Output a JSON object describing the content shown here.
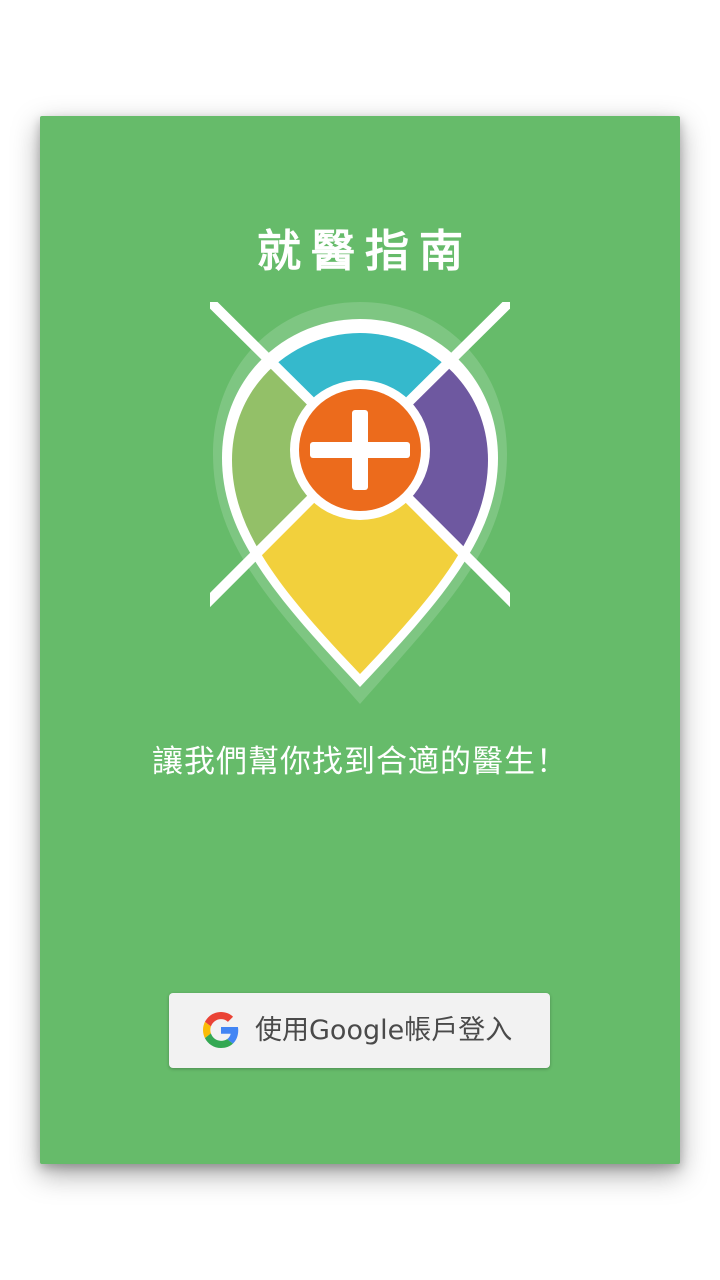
{
  "app": {
    "title": "就醫指南",
    "tagline": "讓我們幫你找到合適的醫生！"
  },
  "signin": {
    "label": "使用Google帳戶登入",
    "icon": "google-g-icon"
  },
  "colors": {
    "background": "#66bb6a",
    "segment_top": "#35b9cc",
    "segment_left": "#93c068",
    "segment_right": "#6e58a0",
    "segment_bottom": "#f2d03c",
    "center": "#ec6b1c",
    "button": "#f2f2f2"
  }
}
